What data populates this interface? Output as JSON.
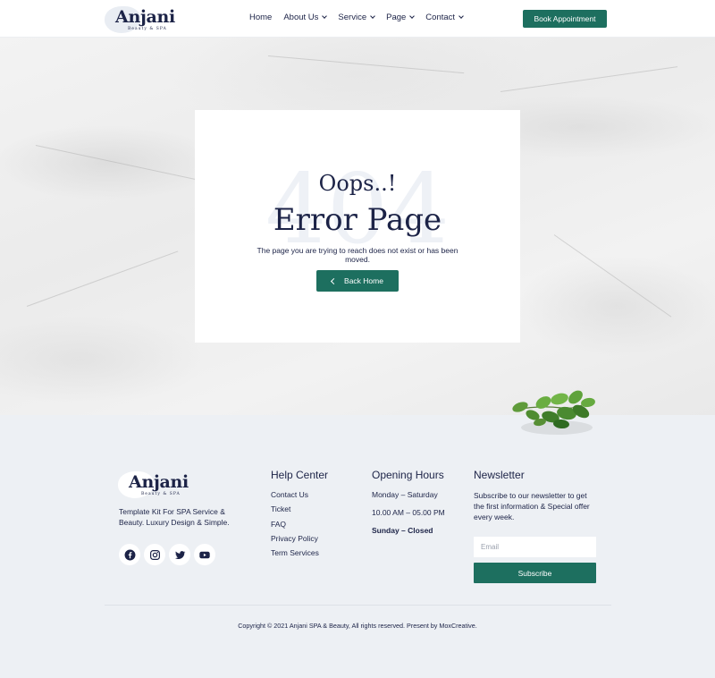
{
  "brand": {
    "name": "Anjani",
    "tagline": "Beauty & SPA"
  },
  "nav": {
    "items": [
      {
        "label": "Home",
        "dropdown": false
      },
      {
        "label": "About Us",
        "dropdown": true
      },
      {
        "label": "Service",
        "dropdown": true
      },
      {
        "label": "Page",
        "dropdown": true
      },
      {
        "label": "Contact",
        "dropdown": true
      }
    ],
    "cta": "Book Appointment"
  },
  "error": {
    "code": "404",
    "heading": "Oops..!",
    "title": "Error Page",
    "message": "The page you are trying to reach does not exist or has been moved.",
    "button": "Back Home"
  },
  "footer": {
    "description": "Template Kit For SPA Service & Beauty. Luxury Design & Simple.",
    "socials": [
      "facebook-icon",
      "instagram-icon",
      "twitter-icon",
      "youtube-icon"
    ],
    "help": {
      "title": "Help Center",
      "links": [
        "Contact Us",
        "Ticket",
        "FAQ",
        "Privacy Policy",
        "Term Services"
      ]
    },
    "hours": {
      "title": "Opening Hours",
      "days": "Monday – Saturday",
      "time": "10.00 AM – 05.00 PM",
      "closed": "Sunday – Closed"
    },
    "newsletter": {
      "title": "Newsletter",
      "text": "Subscribe to our newsletter to get the first information & Special offer every week.",
      "placeholder": "Email",
      "button": "Subscribe"
    },
    "copyright": "Copyright © 2021 Anjani SPA & Beauty, All rights reserved. Present by MoxCreative."
  },
  "colors": {
    "accent": "#1d6f5f",
    "navy": "#1c2347",
    "footer_bg": "#edf0f4"
  }
}
